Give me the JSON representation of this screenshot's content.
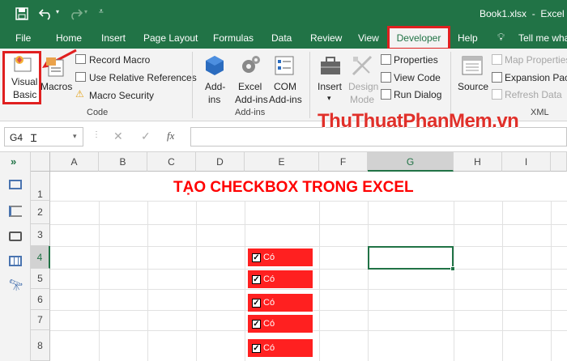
{
  "titlebar": {
    "title": "Book1.xlsx  -  Excel",
    "save_icon": "save-icon",
    "undo_icon": "undo-icon",
    "redo_icon": "redo-icon"
  },
  "tabs": [
    "File",
    "Home",
    "Insert",
    "Page Layout",
    "Formulas",
    "Data",
    "Review",
    "View",
    "Developer",
    "Help"
  ],
  "tell_me": "Tell me wha",
  "ribbon": {
    "code": {
      "visual_basic_1": "Visual",
      "visual_basic_2": "Basic",
      "macros": "Macros",
      "record_macro": "Record Macro",
      "relative_refs": "Use Relative References",
      "macro_security": "Macro Security",
      "label": "Code"
    },
    "addins": {
      "addins_1": "Add-",
      "addins_2": "ins",
      "excel_addins_1": "Excel",
      "excel_addins_2": "Add-ins",
      "com_addins_1": "COM",
      "com_addins_2": "Add-ins",
      "label": "Add-ins"
    },
    "controls": {
      "insert": "Insert",
      "design_mode_1": "Design",
      "design_mode_2": "Mode",
      "properties": "Properties",
      "view_code": "View Code",
      "run_dialog": "Run Dialog"
    },
    "xml": {
      "source": "Source",
      "map_properties": "Map Properties",
      "expansion_packs": "Expansion Pack",
      "refresh_data": "Refresh Data",
      "label": "XML"
    }
  },
  "namebox": "G4",
  "fx": "fx",
  "watermark": "ThuThuatPhanMem.vn",
  "columns": [
    "A",
    "B",
    "C",
    "D",
    "E",
    "F",
    "G",
    "H",
    "I"
  ],
  "rows": [
    "1",
    "2",
    "3",
    "4",
    "5",
    "6",
    "7",
    "8"
  ],
  "sheet_title": "TẠO CHECKBOX TRONG EXCEL",
  "checkbox_label": "Có",
  "colors": {
    "excel_green": "#217346",
    "highlight_red": "#e02020",
    "checkbox_fill": "#ff2020",
    "title_red": "#ff0000"
  }
}
